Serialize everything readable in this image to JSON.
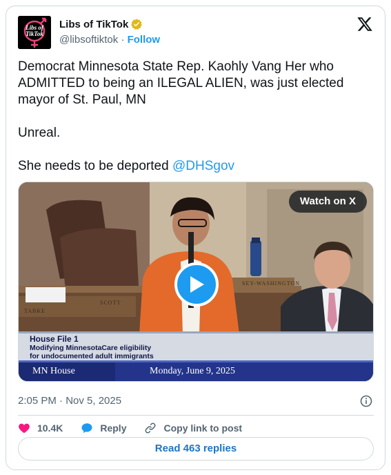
{
  "account": {
    "display_name": "Libs of TikTok",
    "handle": "@libsoftiktok",
    "separator": "·",
    "follow_label": "Follow",
    "avatar_text_line1": "Libs of",
    "avatar_text_line2": "TikTok"
  },
  "tweet": {
    "line1": "Democrat Minnesota State Rep. Kaohly Vang Her who ADMITTED to being an ILEGAL ALIEN, was just elected mayor of St. Paul, MN",
    "line2": "Unreal.",
    "line3_prefix": "She needs to be deported ",
    "mention": "@DHSgov"
  },
  "media": {
    "watch_label": "Watch on X",
    "lower_third_heading": "House File  1",
    "lower_third_sub1": "Modifying MinnesotaCare eligibility",
    "lower_third_sub2": "for undocumented adult immigrants",
    "lower_third_channel": "MN House",
    "lower_third_date": "Monday, June 9, 2025",
    "nameplate_left": "TABKE",
    "nameplate_mid": "SCOTT",
    "nameplate_right": "SEY-WASHINGTON"
  },
  "meta": {
    "timestamp": "2:05 PM · Nov 5, 2025"
  },
  "actions": {
    "like_count": "10.4K",
    "reply_label": "Reply",
    "copy_label": "Copy link to post"
  },
  "read_replies_label": "Read 463 replies",
  "colors": {
    "accent": "#1d9bf0",
    "like": "#f91880",
    "text": "#0f1419",
    "muted": "#536471"
  }
}
